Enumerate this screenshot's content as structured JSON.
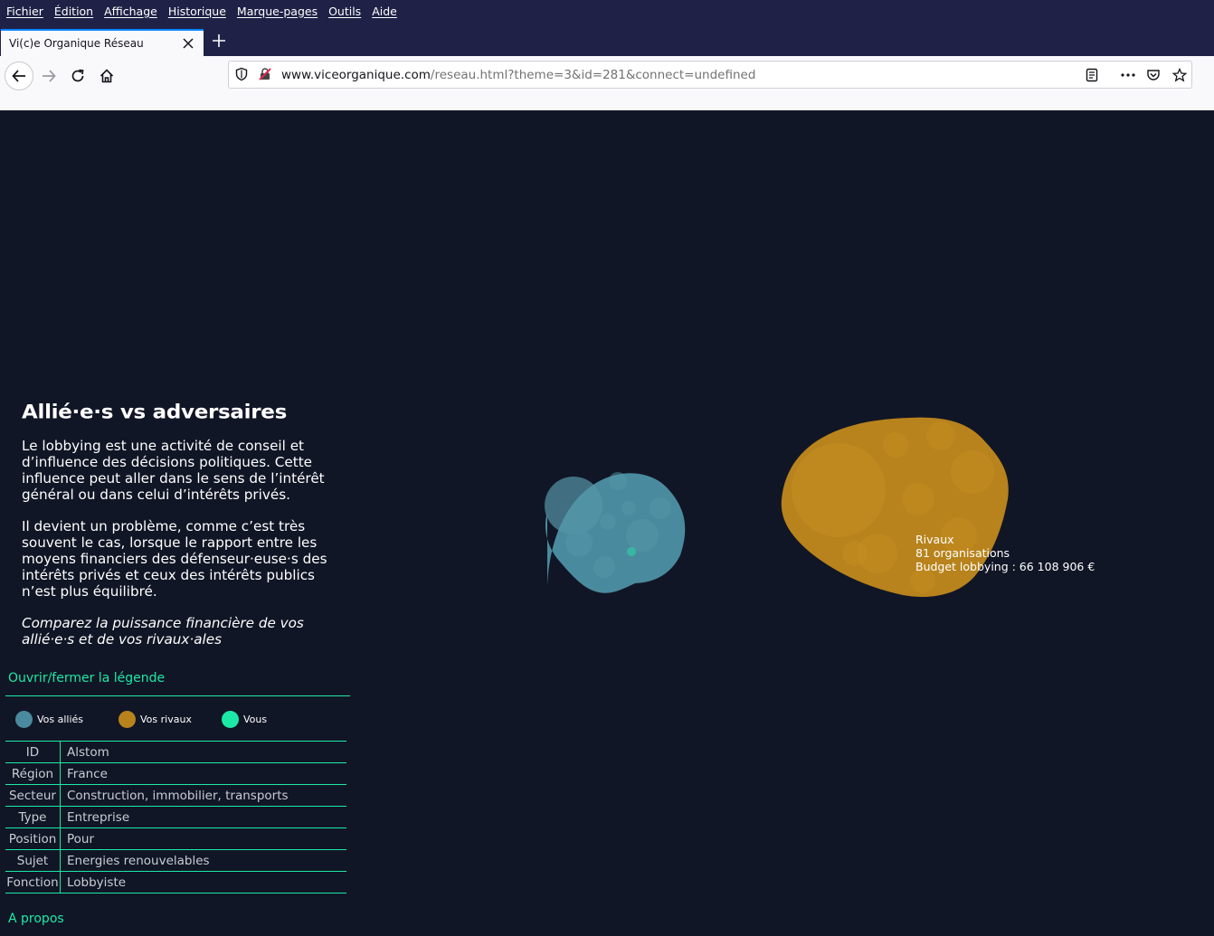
{
  "menu": [
    "Fichier",
    "Édition",
    "Affichage",
    "Historique",
    "Marque-pages",
    "Outils",
    "Aide"
  ],
  "tab": {
    "title": "Vi(c)e Organique Réseau"
  },
  "url": {
    "domain": "www.viceorganique.com",
    "path": "/reseau.html?theme=3&id=281&connect=undefined"
  },
  "intro": {
    "title": "Allié·e·s vs adversaires",
    "p1": "Le lobbying est une activité de conseil et d’influence des décisions politiques. Cette influence peut aller dans le sens de l’intérêt général ou dans celui d’intérêts privés.",
    "p2": "Il devient un problème, comme c’est très souvent le cas, lorsque le rapport entre les moyens financiers des défenseur·euse·s des intérêts privés et ceux des intérêts publics n’est plus équilibré.",
    "p3": "Comparez la puissance financière de vos allié·e·s et de vos rivaux·ales"
  },
  "legend": {
    "toggle": "Ouvrir/fermer la légende",
    "items": [
      {
        "label": "Vos alliés",
        "color": "#4a8a9e"
      },
      {
        "label": "Vos rivaux",
        "color": "#b8831c"
      },
      {
        "label": "Vous",
        "color": "#1de9a6"
      }
    ]
  },
  "info": {
    "rows": [
      {
        "key": "ID",
        "value": "Alstom"
      },
      {
        "key": "Région",
        "value": "France"
      },
      {
        "key": "Secteur",
        "value": "Construction, immobilier, transports"
      },
      {
        "key": "Type",
        "value": "Entreprise"
      },
      {
        "key": "Position",
        "value": "Pour"
      },
      {
        "key": "Sujet",
        "value": "Energies renouvelables"
      },
      {
        "key": "Fonction",
        "value": "Lobbyiste"
      }
    ]
  },
  "about": "A propos",
  "rivals_tooltip": {
    "name": "Rivaux",
    "count": "81 organisations",
    "budget": "Budget lobbying : 66 108 906 €"
  },
  "colors": {
    "accent": "#1de9a6",
    "allies": "#4a8a9e",
    "rivals": "#b8831c",
    "background": "#111626"
  }
}
